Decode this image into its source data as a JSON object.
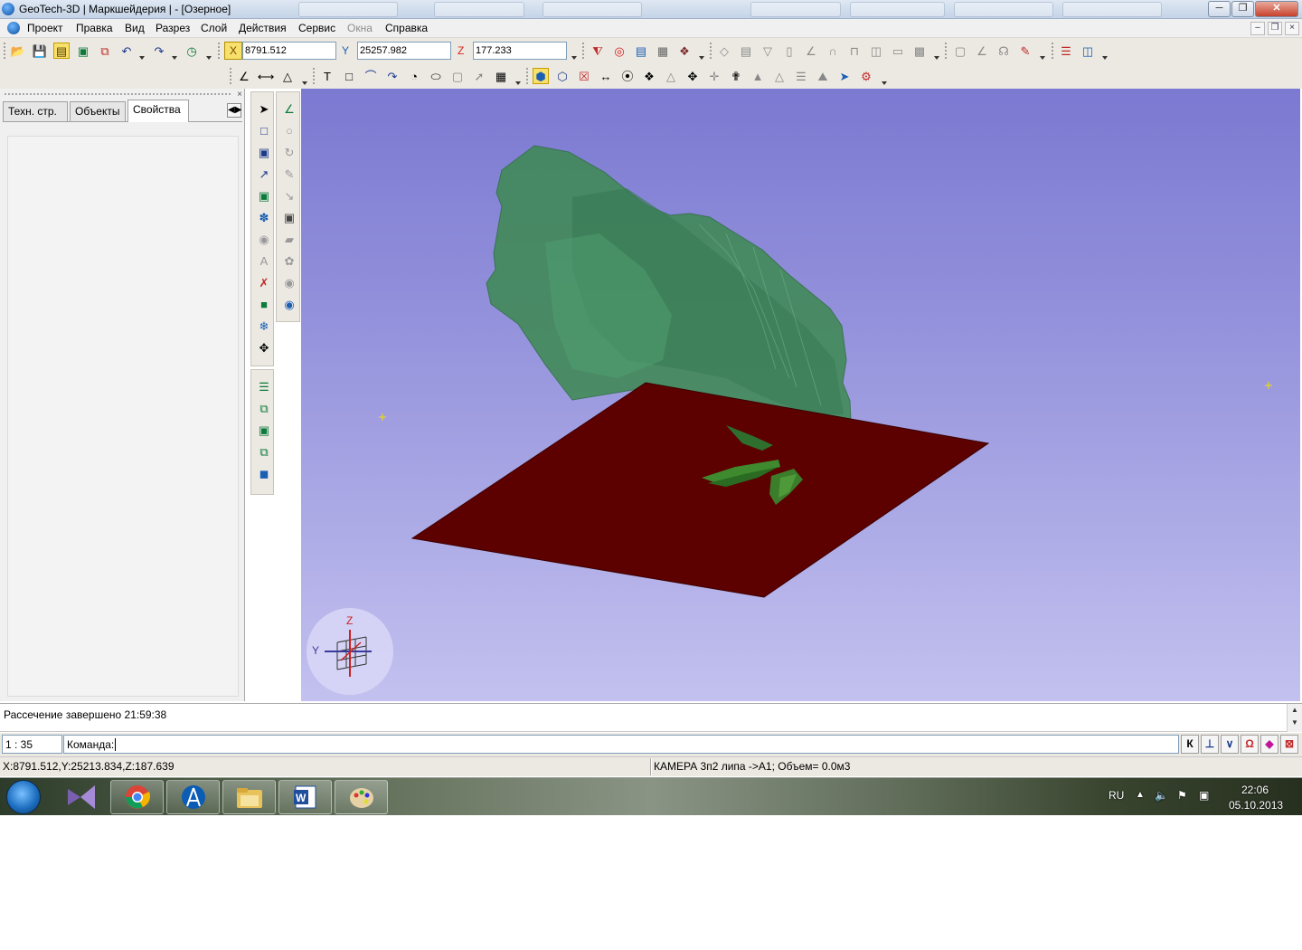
{
  "window": {
    "title": "GeoTech-3D | Маркшейдерия | - [Озерное]"
  },
  "menu": {
    "items": [
      {
        "label": "Проект",
        "disabled": false
      },
      {
        "label": "Правка",
        "disabled": false
      },
      {
        "label": "Вид",
        "disabled": false
      },
      {
        "label": "Разрез",
        "disabled": false
      },
      {
        "label": "Слой",
        "disabled": false
      },
      {
        "label": "Действия",
        "disabled": false
      },
      {
        "label": "Сервис",
        "disabled": false
      },
      {
        "label": "Окна",
        "disabled": true
      },
      {
        "label": "Справка",
        "disabled": false
      }
    ]
  },
  "coords": {
    "x_value": "8791.512",
    "y_label": "Y",
    "y_value": "25257.982",
    "z_label": "Z",
    "z_value": "177.233"
  },
  "left_panel": {
    "tabs": [
      "Техн. стр.",
      "Объекты",
      "Свойства"
    ],
    "active_tab": "Свойства"
  },
  "viewport": {
    "axis_z": "Z",
    "axis_y": "Y",
    "colors": {
      "bg_top": "#7b79d1",
      "bg_bottom": "#c3c1ef",
      "body_fill": "#3f8a55",
      "plane_fill": "#5c0000"
    }
  },
  "messages": {
    "last": "Рассечение завершено 21:59:38"
  },
  "command": {
    "scale": "1 : 35",
    "prompt": "Команда: "
  },
  "snap_buttons": [
    "К",
    "⊥",
    "∨",
    "Ω",
    "◆",
    "⊠"
  ],
  "status": {
    "coords": "X:8791.512,Y:25213.834,Z:187.639",
    "info": "КАМЕРА 3п2 липа ->А1; Объем= 0.0м3"
  },
  "taskbar": {
    "lang": "RU",
    "time": "22:06",
    "date": "05.10.2013"
  }
}
